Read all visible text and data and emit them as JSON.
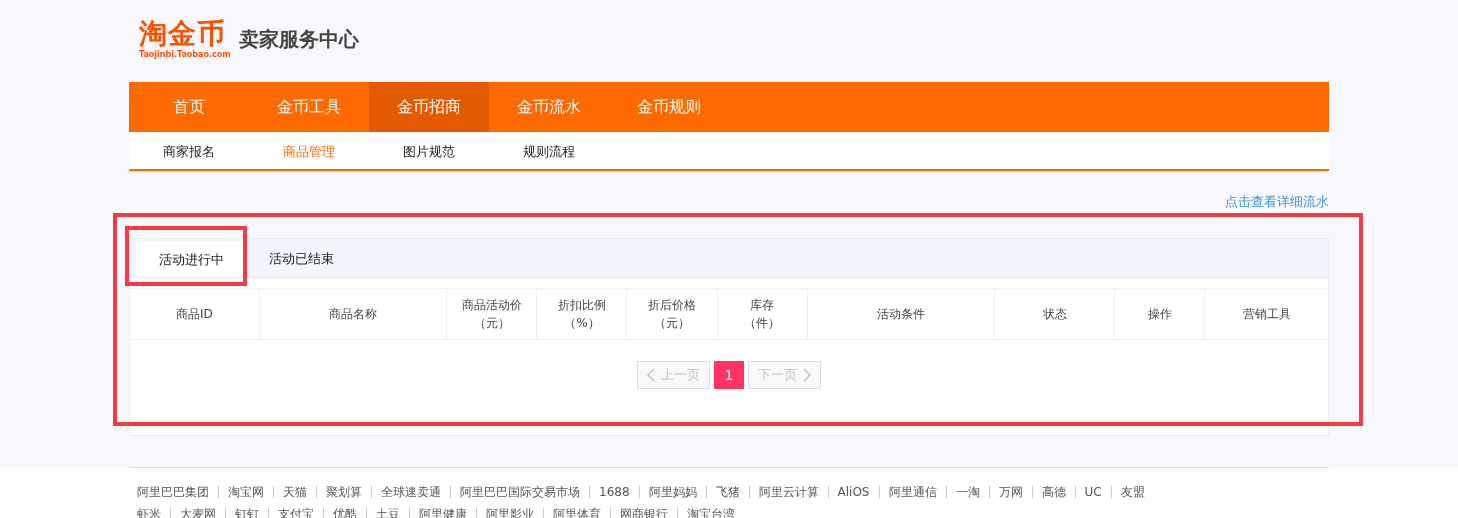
{
  "logo": {
    "mark": "淘金币",
    "domain": "Taojinbi.Taobao.com",
    "title": "卖家服务中心"
  },
  "nav": [
    {
      "label": "首页",
      "selected": false
    },
    {
      "label": "金币工具",
      "selected": false
    },
    {
      "label": "金币招商",
      "selected": true
    },
    {
      "label": "金币流水",
      "selected": false
    },
    {
      "label": "金币规则",
      "selected": false
    }
  ],
  "subnav": [
    {
      "label": "商家报名",
      "selected": false
    },
    {
      "label": "商品管理",
      "selected": true
    },
    {
      "label": "图片规范",
      "selected": false
    },
    {
      "label": "规则流程",
      "selected": false
    }
  ],
  "detail_link": "点击查看详细流水",
  "tabs": [
    {
      "label": "活动进行中",
      "selected": true
    },
    {
      "label": "活动已结束",
      "selected": false
    }
  ],
  "table": {
    "columns": [
      [
        "商品ID"
      ],
      [
        "商品名称"
      ],
      [
        "商品活动价",
        "（元）"
      ],
      [
        "折扣比例",
        "（%）"
      ],
      [
        "折后价格",
        "（元）"
      ],
      [
        "库存",
        "（件）"
      ],
      [
        "活动条件"
      ],
      [
        "状态"
      ],
      [
        "操作"
      ],
      [
        "营销工具"
      ]
    ]
  },
  "pagination": {
    "prev": "上一页",
    "pages": [
      {
        "label": "1",
        "selected": true
      }
    ],
    "next": "下一页",
    "prev_disabled": true,
    "next_disabled": true
  },
  "highlights": {
    "active_tab": true,
    "panel": true
  },
  "footer_links": [
    [
      "阿里巴巴集团",
      "淘宝网",
      "天猫",
      "聚划算",
      "全球速卖通",
      "阿里巴巴国际交易市场",
      "1688",
      "阿里妈妈",
      "飞猪",
      "阿里云计算",
      "AliOS",
      "阿里通信",
      "一淘",
      "万网",
      "高德",
      "UC",
      "友盟"
    ],
    [
      "虾米",
      "大麦网",
      "钉钉",
      "支付宝",
      "优酷",
      "土豆",
      "阿里健康",
      "阿里影业",
      "阿里体育",
      "网商银行",
      "淘宝台湾"
    ]
  ]
}
